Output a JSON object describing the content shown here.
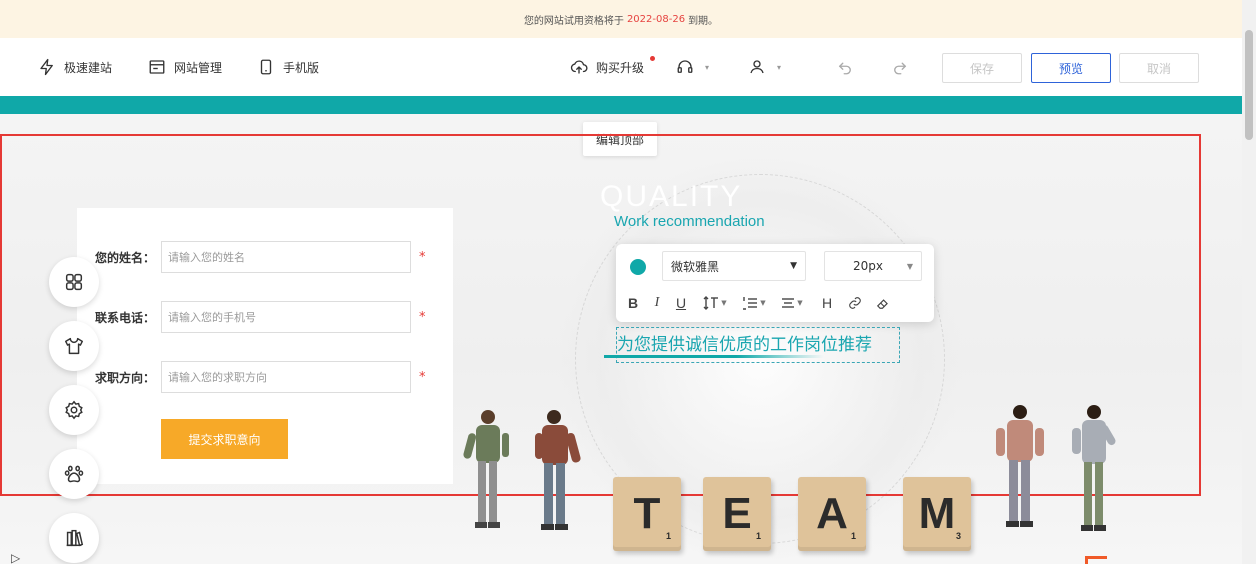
{
  "notice": {
    "prefix": "您的网站试用资格将于",
    "date": "2022-08-26",
    "suffix": "到期。"
  },
  "toolbar": {
    "quick_build": "极速建站",
    "site_manage": "网站管理",
    "mobile": "手机版",
    "upgrade": "购买升级",
    "save": "保存",
    "preview": "预览",
    "cancel": "取消"
  },
  "canvas": {
    "edit_top": "编辑顶部",
    "ghost_text": "QUALITY"
  },
  "form": {
    "fields": [
      {
        "label": "您的姓名：",
        "placeholder": "请输入您的姓名",
        "required": "*"
      },
      {
        "label": "联系电话：",
        "placeholder": "请输入您的手机号",
        "required": "*"
      },
      {
        "label": "求职方向：",
        "placeholder": "请输入您的求职方向",
        "required": "*"
      }
    ],
    "submit": "提交求职意向"
  },
  "heading": {
    "title": "Work recommendation",
    "subtitle": "为您提供诚信优质的工作岗位推荐"
  },
  "rich_text_toolbar": {
    "color": "#10a8a8",
    "font_family": "微软雅黑",
    "font_size": "20px",
    "heading_label": "H"
  },
  "team_tiles": [
    {
      "letter": "T",
      "sub": "1"
    },
    {
      "letter": "E",
      "sub": "1"
    },
    {
      "letter": "A",
      "sub": "1"
    },
    {
      "letter": "M",
      "sub": "3"
    }
  ],
  "side_buttons": [
    "grid-icon",
    "shirt-icon",
    "settings-icon",
    "paw-icon",
    "book-icon"
  ],
  "colors": {
    "teal": "#10a8a8",
    "selection_red": "#e53935",
    "submit_orange": "#f7a928",
    "preview_blue": "#2e63d9"
  }
}
